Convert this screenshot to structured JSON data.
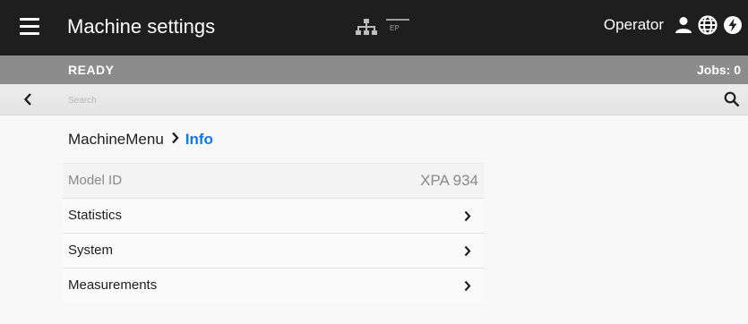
{
  "header": {
    "title": "Machine settings",
    "ep_label": "EP",
    "user_label": "Operator",
    "menu_icon": "hamburger-menu-icon",
    "network_icon": "network-icon",
    "user_icon": "person-icon",
    "language_icon": "globe-icon",
    "power_icon": "power-icon",
    "bg_color": "#1e1e1e"
  },
  "status": {
    "state": "READY",
    "jobs": "Jobs: 0",
    "bg_color": "#8c8c8c"
  },
  "search": {
    "placeholder": "Search",
    "back_icon": "chevron-left-icon",
    "search_icon": "search-icon"
  },
  "breadcrumb": {
    "parent": "MachineMenu",
    "separator_icon": "chevron-right-icon",
    "current": "Info",
    "current_color": "#1976d2"
  },
  "info": {
    "model_id": {
      "label": "Model ID",
      "value": "XPA 934"
    },
    "items": [
      {
        "label": "Statistics"
      },
      {
        "label": "System"
      },
      {
        "label": "Measurements"
      }
    ]
  }
}
